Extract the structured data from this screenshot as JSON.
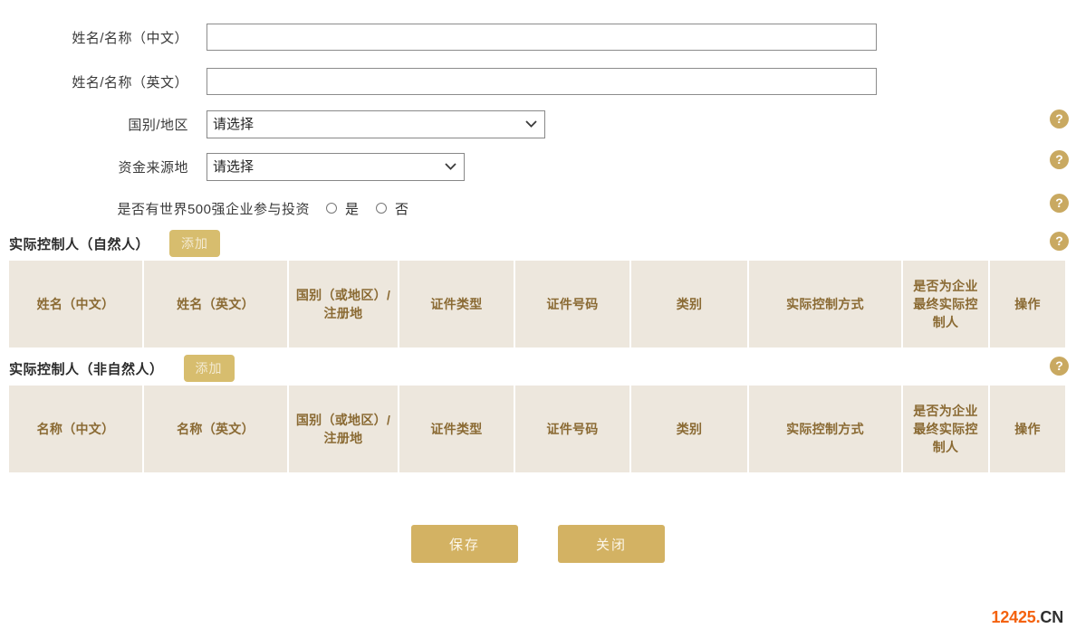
{
  "form": {
    "rows": [
      {
        "label": "姓名/名称（中文）",
        "type": "text",
        "value": "",
        "placeholder": ""
      },
      {
        "label": "姓名/名称（英文）",
        "type": "text",
        "value": "",
        "placeholder": ""
      },
      {
        "label": "国别/地区",
        "type": "select",
        "value": "请选择"
      },
      {
        "label": "资金来源地",
        "type": "select",
        "value": "请选择"
      },
      {
        "label": "是否有世界500强企业参与投资",
        "type": "radio"
      }
    ],
    "radio": {
      "yes_label": "是",
      "no_label": "否",
      "selected": ""
    }
  },
  "help": {
    "glyph": "?",
    "color": "#c9a961",
    "label": "帮助"
  },
  "sections": [
    {
      "title": "实际控制人（自然人）",
      "add_label": "添加",
      "columns": [
        "姓名（中文）",
        "姓名（英文）",
        "国别（或地区）/注册地",
        "证件类型",
        "证件号码",
        "类别",
        "实际控制方式",
        "是否为企业最终实际控制人",
        "操作"
      ],
      "rows": []
    },
    {
      "title": "实际控制人（非自然人）",
      "add_label": "添加",
      "columns": [
        "名称（中文）",
        "名称（英文）",
        "国别（或地区）/注册地",
        "证件类型",
        "证件号码",
        "类别",
        "实际控制方式",
        "是否为企业最终实际控制人",
        "操作"
      ],
      "rows": []
    }
  ],
  "footer": {
    "save_label": "保存",
    "close_label": "关闭"
  },
  "watermark": {
    "number": "12425",
    "dot": ".",
    "tld": "CN"
  }
}
